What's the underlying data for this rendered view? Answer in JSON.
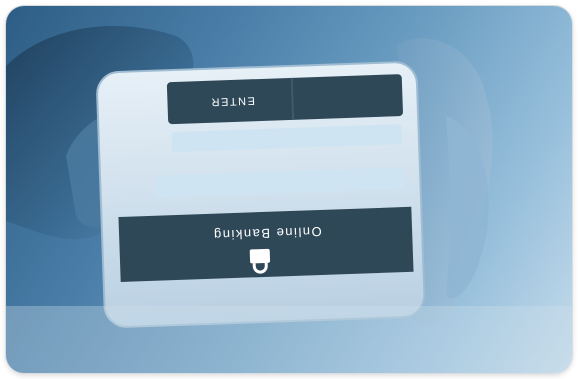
{
  "photo": {
    "subject": "hands holding smartphone with online banking login",
    "tint": "#3d6f97"
  },
  "phone_screen": {
    "enter_label": "ENTER",
    "banking_label": "Online Banking",
    "lock_icon": "padlock-icon",
    "field_color": "#cfe4f2",
    "header_color": "#2f4858"
  }
}
